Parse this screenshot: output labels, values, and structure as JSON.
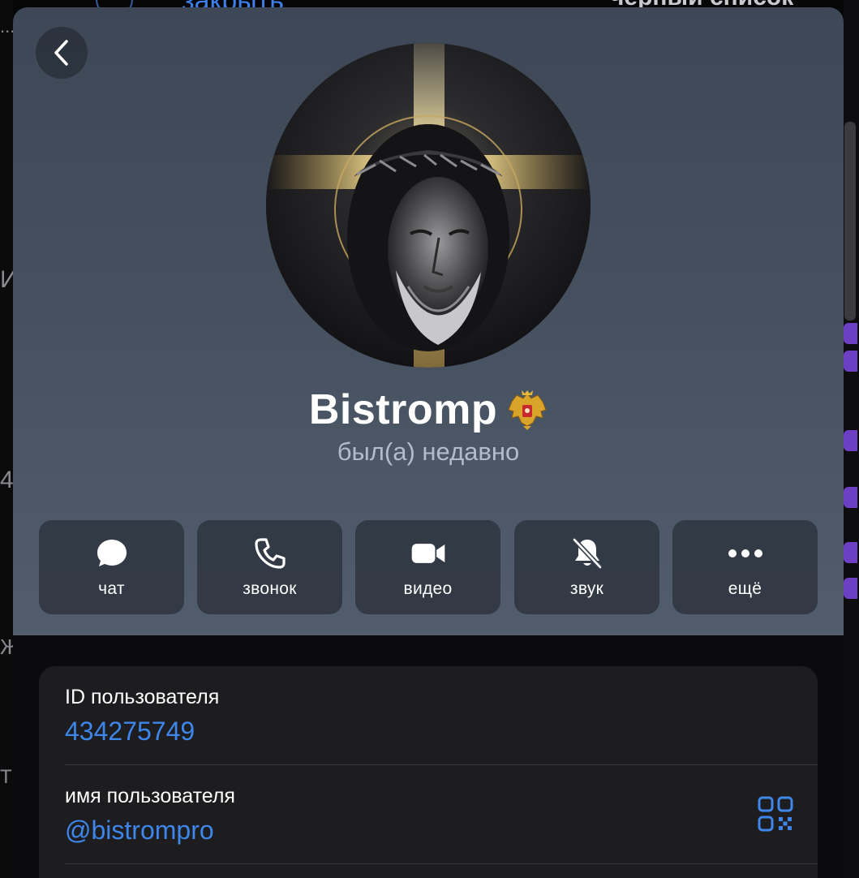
{
  "background": {
    "top_left_text": "закрыть",
    "top_right_text": "черный список",
    "left_fragments": [
      "...",
      "И",
      "4",
      "Ж",
      "ТІ"
    ]
  },
  "profile": {
    "name": "Bistromp",
    "status": "был(а) недавно",
    "emblem_icon": "russian-coat-of-arms-icon",
    "avatar_icon": "jesus-portrait-avatar"
  },
  "actions": [
    {
      "id": "chat",
      "label": "чат",
      "icon": "chat-bubble-icon"
    },
    {
      "id": "call",
      "label": "звонок",
      "icon": "phone-icon"
    },
    {
      "id": "video",
      "label": "видео",
      "icon": "video-camera-icon"
    },
    {
      "id": "sound",
      "label": "звук",
      "icon": "bell-slash-icon"
    },
    {
      "id": "more",
      "label": "ещё",
      "icon": "ellipsis-icon"
    }
  ],
  "info": {
    "user_id_label": "ID пользователя",
    "user_id_value": "434275749",
    "username_label": "имя пользователя",
    "username_value": "@bistrompro"
  },
  "colors": {
    "accent": "#3e86ea",
    "header_top": "#3d4756",
    "header_bottom": "#515d6d",
    "card_bg": "#1d1d20"
  }
}
